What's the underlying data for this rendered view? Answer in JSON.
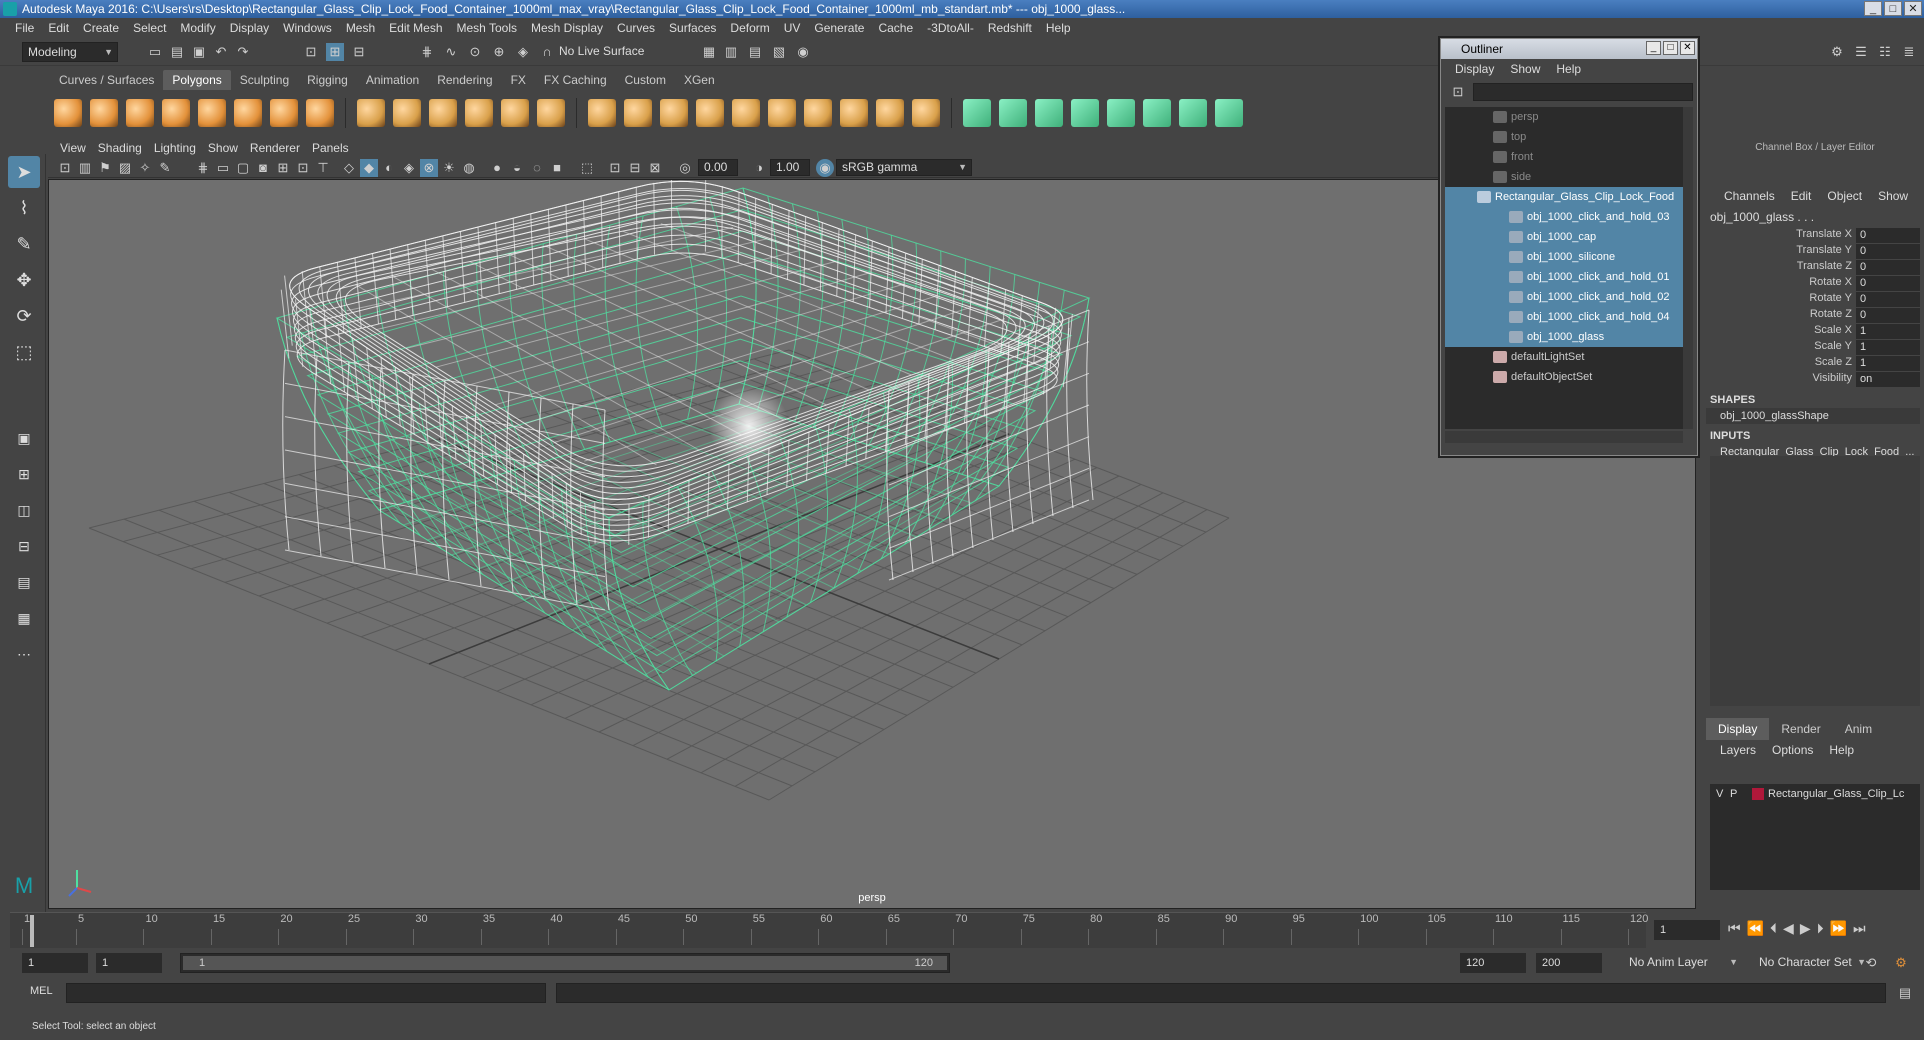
{
  "window": {
    "title": "Autodesk Maya 2016: C:\\Users\\rs\\Desktop\\Rectangular_Glass_Clip_Lock_Food_Container_1000ml_max_vray\\Rectangular_Glass_Clip_Lock_Food_Container_1000ml_mb_standart.mb*  ---  obj_1000_glass...",
    "buttons": [
      "_",
      "□",
      "✕"
    ]
  },
  "menubar": [
    "File",
    "Edit",
    "Create",
    "Select",
    "Modify",
    "Display",
    "Windows",
    "Mesh",
    "Edit Mesh",
    "Mesh Tools",
    "Mesh Display",
    "Curves",
    "Surfaces",
    "Deform",
    "UV",
    "Generate",
    "Cache",
    "-3DtoAll-",
    "Redshift",
    "Help"
  ],
  "statusline": {
    "mode": "Modeling",
    "live_surface": "No Live Surface"
  },
  "shelf": {
    "tabs": [
      "Curves / Surfaces",
      "Polygons",
      "Sculpting",
      "Rigging",
      "Animation",
      "Rendering",
      "FX",
      "FX Caching",
      "Custom",
      "XGen"
    ],
    "active_tab": "Polygons",
    "colors": {
      "primitive": "#e3913a",
      "tool": "#d9a04a",
      "green": "#3fb07a"
    }
  },
  "viewport": {
    "menu": [
      "View",
      "Shading",
      "Lighting",
      "Show",
      "Renderer",
      "Panels"
    ],
    "exposure": "0.00",
    "gamma": "1.00",
    "color_space": "sRGB gamma",
    "camera_label": "persp",
    "colors": {
      "background": "#6f6f6f",
      "grid": "#5a5a5a",
      "wire_white": "#f4f4f4",
      "wire_green": "#4fe0a0"
    }
  },
  "outliner": {
    "title": "Outliner",
    "menu": [
      "Display",
      "Show",
      "Help"
    ],
    "items": [
      {
        "label": "persp",
        "indent": 2,
        "selected": false,
        "dim": true,
        "icon": "camera-icon"
      },
      {
        "label": "top",
        "indent": 2,
        "selected": false,
        "dim": true,
        "icon": "camera-icon"
      },
      {
        "label": "front",
        "indent": 2,
        "selected": false,
        "dim": true,
        "icon": "camera-icon"
      },
      {
        "label": "side",
        "indent": 2,
        "selected": false,
        "dim": true,
        "icon": "camera-icon"
      },
      {
        "label": "Rectangular_Glass_Clip_Lock_Food",
        "indent": 1,
        "selected": true,
        "dim": false,
        "icon": "group-icon"
      },
      {
        "label": "obj_1000_click_and_hold_03",
        "indent": 3,
        "selected": true,
        "dim": false,
        "icon": "mesh-icon"
      },
      {
        "label": "obj_1000_cap",
        "indent": 3,
        "selected": true,
        "dim": false,
        "icon": "mesh-icon"
      },
      {
        "label": "obj_1000_silicone",
        "indent": 3,
        "selected": true,
        "dim": false,
        "icon": "mesh-icon"
      },
      {
        "label": "obj_1000_click_and_hold_01",
        "indent": 3,
        "selected": true,
        "dim": false,
        "icon": "mesh-icon"
      },
      {
        "label": "obj_1000_click_and_hold_02",
        "indent": 3,
        "selected": true,
        "dim": false,
        "icon": "mesh-icon"
      },
      {
        "label": "obj_1000_click_and_hold_04",
        "indent": 3,
        "selected": true,
        "dim": false,
        "icon": "mesh-icon"
      },
      {
        "label": "obj_1000_glass",
        "indent": 3,
        "selected": true,
        "dim": false,
        "icon": "mesh-icon"
      },
      {
        "label": "defaultLightSet",
        "indent": 2,
        "selected": false,
        "dim": false,
        "icon": "set-icon"
      },
      {
        "label": "defaultObjectSet",
        "indent": 2,
        "selected": false,
        "dim": false,
        "icon": "set-icon"
      }
    ]
  },
  "channelbox": {
    "header": "Channel Box / Layer Editor",
    "menu": [
      "Channels",
      "Edit",
      "Object",
      "Show"
    ],
    "object": "obj_1000_glass . . .",
    "channels": [
      {
        "label": "Translate X",
        "value": "0"
      },
      {
        "label": "Translate Y",
        "value": "0"
      },
      {
        "label": "Translate Z",
        "value": "0"
      },
      {
        "label": "Rotate X",
        "value": "0"
      },
      {
        "label": "Rotate Y",
        "value": "0"
      },
      {
        "label": "Rotate Z",
        "value": "0"
      },
      {
        "label": "Scale X",
        "value": "1"
      },
      {
        "label": "Scale Y",
        "value": "1"
      },
      {
        "label": "Scale Z",
        "value": "1"
      },
      {
        "label": "Visibility",
        "value": "on"
      }
    ],
    "shapes_title": "SHAPES",
    "shape": "obj_1000_glassShape",
    "inputs_title": "INPUTS",
    "input": "Rectangular_Glass_Clip_Lock_Food_..."
  },
  "layer_editor": {
    "tabs": [
      "Display",
      "Render",
      "Anim"
    ],
    "active_tab": "Display",
    "menu": [
      "Layers",
      "Options",
      "Help"
    ],
    "layer": {
      "v": "V",
      "p": "P",
      "name": "Rectangular_Glass_Clip_Lc",
      "color": "#b0183a"
    }
  },
  "timeline": {
    "ticks": [
      "1",
      "5",
      "10",
      "15",
      "20",
      "25",
      "30",
      "35",
      "40",
      "45",
      "50",
      "55",
      "60",
      "65",
      "70",
      "75",
      "80",
      "85",
      "90",
      "95",
      "100",
      "105",
      "110",
      "115",
      "120"
    ],
    "current_frame": "1"
  },
  "range": {
    "start": "1",
    "anim_start": "1",
    "slider_start": "1",
    "slider_end": "120",
    "anim_end": "120",
    "end": "200",
    "anim_layer": "No Anim Layer",
    "character_set": "No Character Set"
  },
  "commandline": {
    "label": "MEL"
  },
  "helpline": "Select Tool: select an object"
}
